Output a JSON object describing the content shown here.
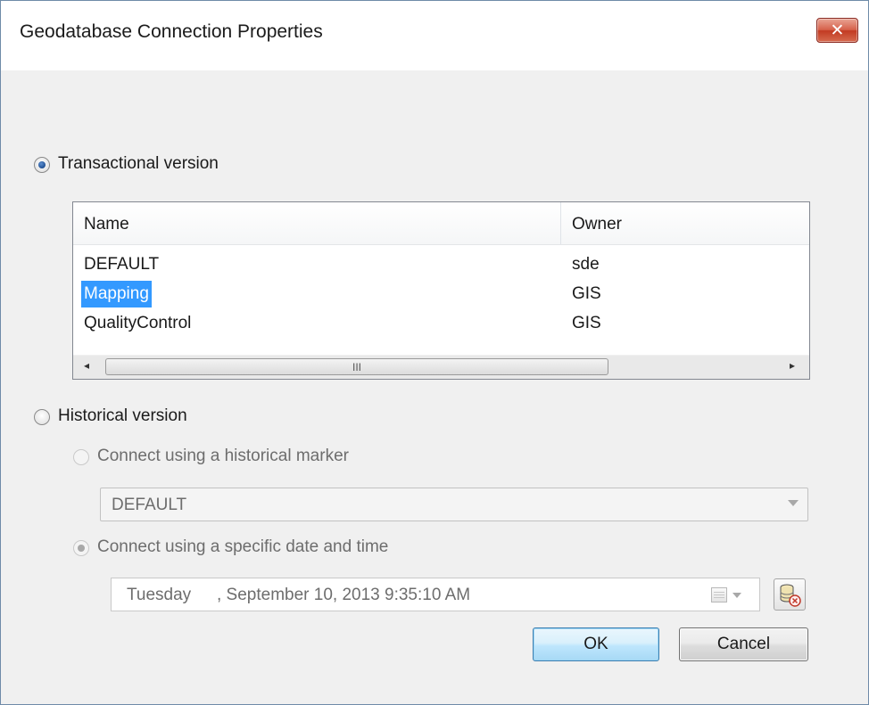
{
  "window": {
    "title": "Geodatabase Connection Properties",
    "close_glyph": "✕"
  },
  "transactional": {
    "label": "Transactional version",
    "selected": true
  },
  "versions_list": {
    "columns": [
      "Name",
      "Owner"
    ],
    "rows": [
      {
        "name": "DEFAULT",
        "owner": "sde"
      },
      {
        "name": "Mapping",
        "owner": "GIS",
        "selected": true
      },
      {
        "name": "QualityControl",
        "owner": "GIS"
      }
    ],
    "scroll_left": "◂",
    "scroll_right": "▸",
    "scroll_grip": "III"
  },
  "historical": {
    "label": "Historical version",
    "selected": false,
    "marker_option": {
      "label": "Connect using a historical marker",
      "enabled": false
    },
    "marker_combo": {
      "value": "DEFAULT"
    },
    "datetime_option": {
      "label": "Connect using a specific date and time",
      "selected": true,
      "enabled": false
    },
    "datetime": {
      "day": "Tuesday",
      "date": ", September 10, 2013   9:35:10 AM"
    }
  },
  "buttons": {
    "ok": "OK",
    "cancel": "Cancel"
  },
  "colors": {
    "selection": "#3399ff",
    "ok_border": "#3c7fb1",
    "close_red": "#c23a22"
  },
  "icons": {
    "calendar": "calendar-icon",
    "database_refresh": "database-icon"
  }
}
